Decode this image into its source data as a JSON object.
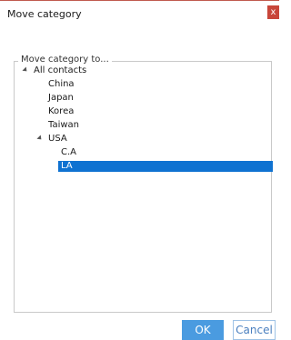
{
  "window": {
    "title": "Move category",
    "close_glyph": "x"
  },
  "group": {
    "label": "Move category to..."
  },
  "tree": {
    "root": "All contacts",
    "children": [
      "China",
      "Japan",
      "Korea",
      "Taiwan",
      "USA"
    ],
    "usa_children": [
      "C.A",
      "LA"
    ],
    "selected": "LA"
  },
  "buttons": {
    "ok": "OK",
    "cancel": "Cancel"
  },
  "colors": {
    "selection": "#0f72d1",
    "ok_button": "#4a9be0",
    "close_button": "#c8463a"
  }
}
